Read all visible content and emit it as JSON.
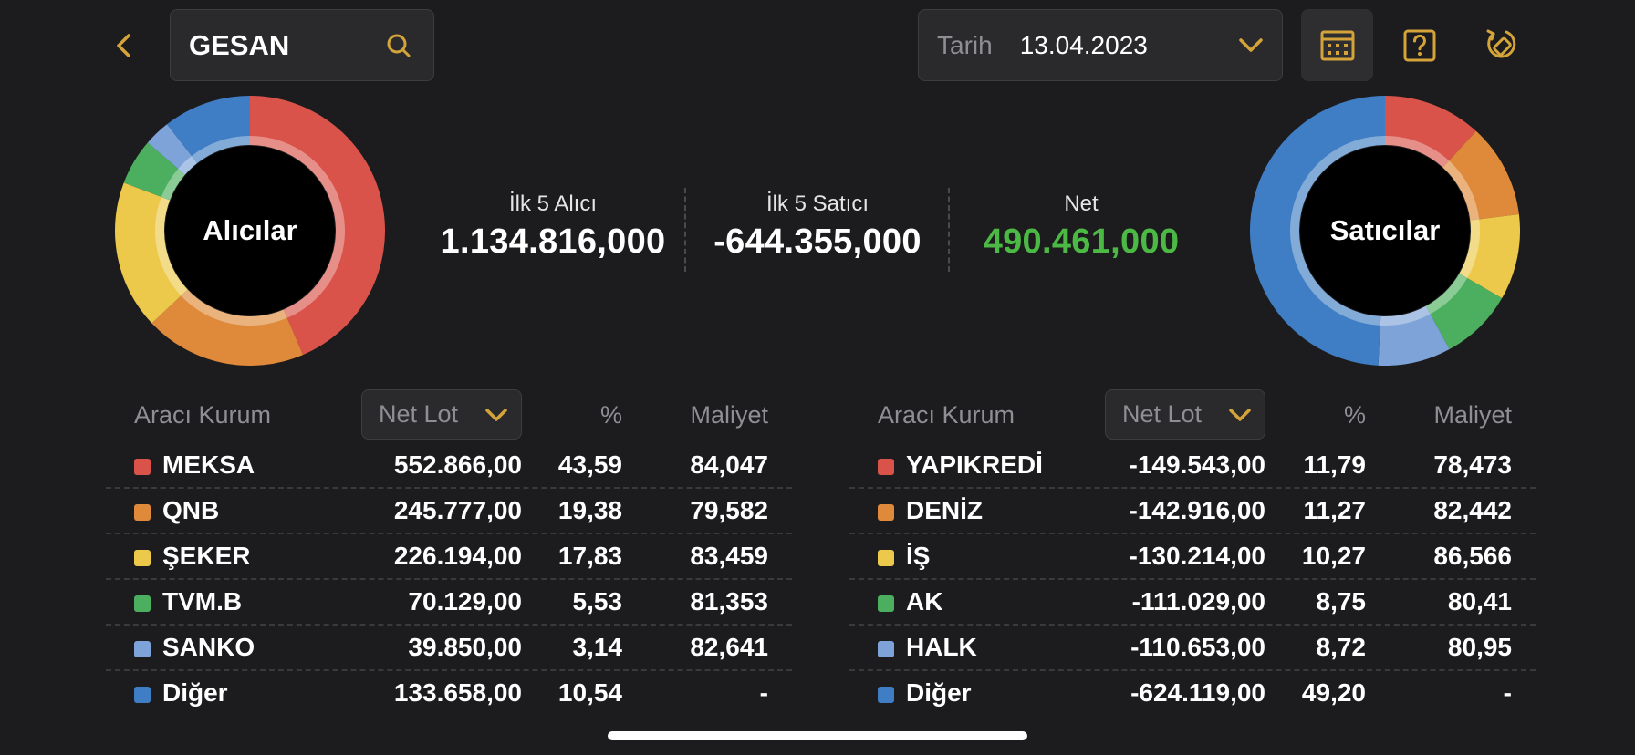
{
  "header": {
    "search_value": "GESAN",
    "date_label": "Tarih",
    "date_value": "13.04.2023"
  },
  "colors": {
    "accent": "#d4a43a",
    "red": "#d9534a",
    "orange": "#df8a3a",
    "yellow": "#ecc94b",
    "green": "#4caf5f",
    "lightblue": "#7ea3d8",
    "blue": "#3f7ec4",
    "net_green": "#4cb944"
  },
  "icons": {
    "back": "chevron-left-icon",
    "search": "search-icon",
    "date_dropdown": "chevron-down-icon",
    "calendar": "calendar-icon",
    "help": "help-icon",
    "rotate": "rotate-icon"
  },
  "buyers_chart": {
    "label": "Alıcılar",
    "slices": [
      {
        "name": "MEKSA",
        "value": 43.59,
        "color": "#d9534a"
      },
      {
        "name": "QNB",
        "value": 19.38,
        "color": "#df8a3a"
      },
      {
        "name": "ŞEKER",
        "value": 17.83,
        "color": "#ecc94b"
      },
      {
        "name": "TVM.B",
        "value": 5.53,
        "color": "#4caf5f"
      },
      {
        "name": "SANKO",
        "value": 3.14,
        "color": "#7ea3d8"
      },
      {
        "name": "Diğer",
        "value": 10.54,
        "color": "#3f7ec4"
      }
    ]
  },
  "sellers_chart": {
    "label": "Satıcılar",
    "slices": [
      {
        "name": "YAPIKREDİ",
        "value": 11.79,
        "color": "#d9534a"
      },
      {
        "name": "DENİZ",
        "value": 11.27,
        "color": "#df8a3a"
      },
      {
        "name": "İŞ",
        "value": 10.27,
        "color": "#ecc94b"
      },
      {
        "name": "AK",
        "value": 8.75,
        "color": "#4caf5f"
      },
      {
        "name": "HALK",
        "value": 8.72,
        "color": "#7ea3d8"
      },
      {
        "name": "Diğer",
        "value": 49.2,
        "color": "#3f7ec4"
      }
    ]
  },
  "summary": {
    "buyers_label": "İlk 5 Alıcı",
    "buyers_value": "1.134.816,000",
    "sellers_label": "İlk 5 Satıcı",
    "sellers_value": "-644.355,000",
    "net_label": "Net",
    "net_value": "490.461,000"
  },
  "buyers_table": {
    "col_broker": "Aracı Kurum",
    "col_lot": "Net Lot",
    "col_pct": "%",
    "col_cost": "Maliyet",
    "rows": [
      {
        "name": "MEKSA",
        "lot": "552.866,00",
        "pct": "43,59",
        "cost": "84,047",
        "color": "#d9534a"
      },
      {
        "name": "QNB",
        "lot": "245.777,00",
        "pct": "19,38",
        "cost": "79,582",
        "color": "#df8a3a"
      },
      {
        "name": "ŞEKER",
        "lot": "226.194,00",
        "pct": "17,83",
        "cost": "83,459",
        "color": "#ecc94b"
      },
      {
        "name": "TVM.B",
        "lot": "70.129,00",
        "pct": "5,53",
        "cost": "81,353",
        "color": "#4caf5f"
      },
      {
        "name": "SANKO",
        "lot": "39.850,00",
        "pct": "3,14",
        "cost": "82,641",
        "color": "#7ea3d8"
      },
      {
        "name": "Diğer",
        "lot": "133.658,00",
        "pct": "10,54",
        "cost": "-",
        "color": "#3f7ec4"
      }
    ]
  },
  "sellers_table": {
    "col_broker": "Aracı Kurum",
    "col_lot": "Net Lot",
    "col_pct": "%",
    "col_cost": "Maliyet",
    "rows": [
      {
        "name": "YAPIKREDİ",
        "lot": "-149.543,00",
        "pct": "11,79",
        "cost": "78,473",
        "color": "#d9534a"
      },
      {
        "name": "DENİZ",
        "lot": "-142.916,00",
        "pct": "11,27",
        "cost": "82,442",
        "color": "#df8a3a"
      },
      {
        "name": "İŞ",
        "lot": "-130.214,00",
        "pct": "10,27",
        "cost": "86,566",
        "color": "#ecc94b"
      },
      {
        "name": "AK",
        "lot": "-111.029,00",
        "pct": "8,75",
        "cost": "80,41",
        "color": "#4caf5f"
      },
      {
        "name": "HALK",
        "lot": "-110.653,00",
        "pct": "8,72",
        "cost": "80,95",
        "color": "#7ea3d8"
      },
      {
        "name": "Diğer",
        "lot": "-624.119,00",
        "pct": "49,20",
        "cost": "-",
        "color": "#3f7ec4"
      }
    ]
  }
}
